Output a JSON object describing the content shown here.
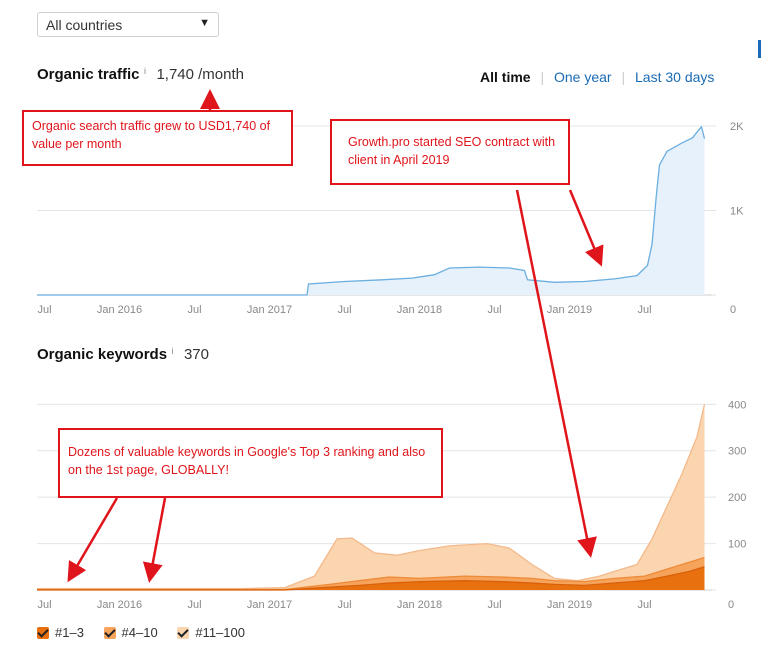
{
  "country_select": {
    "value": "All countries"
  },
  "traffic": {
    "title": "Organic traffic",
    "info": "i",
    "value": "1,740 /month",
    "ranges": [
      "All time",
      "One year",
      "Last 30 days"
    ],
    "sep": "|"
  },
  "keywords": {
    "title": "Organic keywords",
    "info": "i",
    "value": "370"
  },
  "callouts": {
    "traffic_value": "Organic search traffic grew to USD1,740 of value per month",
    "contract": "Growth.pro started SEO contract with client in April 2019",
    "keywords": "Dozens of valuable keywords in Google's Top 3 ranking and also on the 1st page, GLOBALLY!"
  },
  "legend": [
    {
      "label": "#1–3",
      "color": "#e8700e"
    },
    {
      "label": "#4–10",
      "color": "#f6a35b"
    },
    {
      "label": "#11–100",
      "color": "#fad5b0"
    }
  ],
  "colors": {
    "annotation": "#e0141b",
    "traffic_line": "#6aaee0",
    "traffic_fill": "#e6f1fb"
  },
  "chart_data": [
    {
      "type": "area",
      "title": "Organic traffic",
      "x_tick_labels": [
        "Jul",
        "Jan 2016",
        "Jul",
        "Jan 2017",
        "Jul",
        "Jan 2018",
        "Jul",
        "Jan 2019",
        "Jul"
      ],
      "x_ticks": [
        2015.5,
        2016.0,
        2016.5,
        2017.0,
        2017.5,
        2018.0,
        2018.5,
        2019.0,
        2019.5
      ],
      "xlim": [
        2015.45,
        2019.95
      ],
      "y_tick_labels": [
        "2K",
        "1K",
        "0"
      ],
      "y_ticks": [
        2000,
        1000,
        0
      ],
      "ylim": [
        0,
        2000
      ],
      "grid": true,
      "series": [
        {
          "values": [
            [
              2015.45,
              0
            ],
            [
              2017.25,
              0
            ],
            [
              2017.26,
              130
            ],
            [
              2017.5,
              160
            ],
            [
              2017.75,
              180
            ],
            [
              2017.95,
              200
            ],
            [
              2018.1,
              240
            ],
            [
              2018.2,
              320
            ],
            [
              2018.4,
              330
            ],
            [
              2018.6,
              320
            ],
            [
              2018.7,
              290
            ],
            [
              2018.72,
              180
            ],
            [
              2018.9,
              150
            ],
            [
              2019.1,
              160
            ],
            [
              2019.3,
              190
            ],
            [
              2019.45,
              230
            ],
            [
              2019.52,
              350
            ],
            [
              2019.55,
              600
            ],
            [
              2019.58,
              1200
            ],
            [
              2019.6,
              1540
            ],
            [
              2019.65,
              1700
            ],
            [
              2019.75,
              1800
            ],
            [
              2019.82,
              1860
            ],
            [
              2019.86,
              1950
            ],
            [
              2019.88,
              1990
            ],
            [
              2019.9,
              1850
            ]
          ]
        }
      ]
    },
    {
      "type": "area",
      "title": "Organic keywords",
      "x_tick_labels": [
        "Jul",
        "Jan 2016",
        "Jul",
        "Jan 2017",
        "Jul",
        "Jan 2018",
        "Jul",
        "Jan 2019",
        "Jul"
      ],
      "x_ticks": [
        2015.5,
        2016.0,
        2016.5,
        2017.0,
        2017.5,
        2018.0,
        2018.5,
        2019.0,
        2019.5
      ],
      "xlim": [
        2015.45,
        2019.95
      ],
      "y_tick_labels": [
        "400",
        "300",
        "200",
        "100",
        "0"
      ],
      "y_ticks": [
        400,
        300,
        200,
        100,
        0
      ],
      "ylim": [
        0,
        420
      ],
      "grid": true,
      "stacked": false,
      "series": [
        {
          "name": "#11–100",
          "values": [
            [
              2015.45,
              3
            ],
            [
              2016.8,
              3
            ],
            [
              2017.1,
              5
            ],
            [
              2017.3,
              30
            ],
            [
              2017.45,
              110
            ],
            [
              2017.55,
              112
            ],
            [
              2017.7,
              80
            ],
            [
              2017.85,
              75
            ],
            [
              2018.0,
              85
            ],
            [
              2018.2,
              95
            ],
            [
              2018.45,
              100
            ],
            [
              2018.6,
              90
            ],
            [
              2018.75,
              55
            ],
            [
              2018.9,
              25
            ],
            [
              2019.05,
              20
            ],
            [
              2019.2,
              30
            ],
            [
              2019.3,
              40
            ],
            [
              2019.45,
              55
            ],
            [
              2019.55,
              110
            ],
            [
              2019.65,
              180
            ],
            [
              2019.75,
              250
            ],
            [
              2019.85,
              330
            ],
            [
              2019.9,
              400
            ]
          ]
        },
        {
          "name": "#4–10",
          "values": [
            [
              2015.45,
              1
            ],
            [
              2017.1,
              1
            ],
            [
              2017.4,
              12
            ],
            [
              2017.6,
              20
            ],
            [
              2017.8,
              28
            ],
            [
              2018.0,
              25
            ],
            [
              2018.3,
              30
            ],
            [
              2018.55,
              28
            ],
            [
              2018.75,
              25
            ],
            [
              2018.9,
              20
            ],
            [
              2019.1,
              18
            ],
            [
              2019.3,
              25
            ],
            [
              2019.5,
              30
            ],
            [
              2019.65,
              45
            ],
            [
              2019.8,
              60
            ],
            [
              2019.9,
              70
            ]
          ]
        },
        {
          "name": "#1–3",
          "values": [
            [
              2015.45,
              0
            ],
            [
              2017.1,
              0
            ],
            [
              2017.4,
              6
            ],
            [
              2017.6,
              10
            ],
            [
              2017.8,
              15
            ],
            [
              2018.0,
              18
            ],
            [
              2018.3,
              20
            ],
            [
              2018.55,
              18
            ],
            [
              2018.75,
              15
            ],
            [
              2018.9,
              12
            ],
            [
              2019.1,
              10
            ],
            [
              2019.3,
              15
            ],
            [
              2019.5,
              20
            ],
            [
              2019.65,
              30
            ],
            [
              2019.8,
              40
            ],
            [
              2019.9,
              50
            ]
          ]
        }
      ]
    }
  ]
}
